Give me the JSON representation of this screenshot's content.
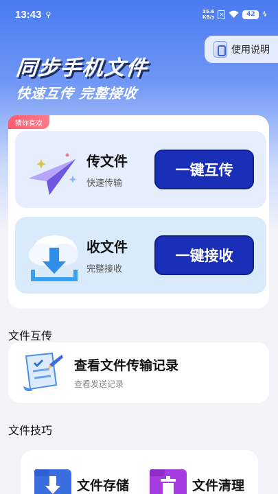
{
  "status_bar": {
    "time": "13:43",
    "net_speed_value": "35.6",
    "net_speed_unit": "KB/s",
    "battery": "42"
  },
  "guide_button": {
    "label": "使用说明"
  },
  "hero": {
    "title": "同步手机文件",
    "subtitle": "快速互传 完整接收"
  },
  "favorite_tag": "猜你喜欢",
  "send_panel": {
    "title": "传文件",
    "desc": "快速传输",
    "button": "一键互传"
  },
  "receive_panel": {
    "title": "收文件",
    "desc": "完整接收",
    "button": "一键接收"
  },
  "sections": {
    "transfer": "文件互传",
    "tips": "文件技巧"
  },
  "record_card": {
    "title": "查看文件传输记录",
    "desc": "查看发送记录"
  },
  "tips": [
    {
      "label": "文件存储",
      "icon": "folder-download-icon",
      "color": "#3b6fe0"
    },
    {
      "label": "文件清理",
      "icon": "folder-trash-icon",
      "color": "#a63be0"
    }
  ],
  "colors": {
    "accent": "#1a2fb8",
    "hero_top": "#4a7bf0",
    "tag": "#ff5a6e"
  }
}
